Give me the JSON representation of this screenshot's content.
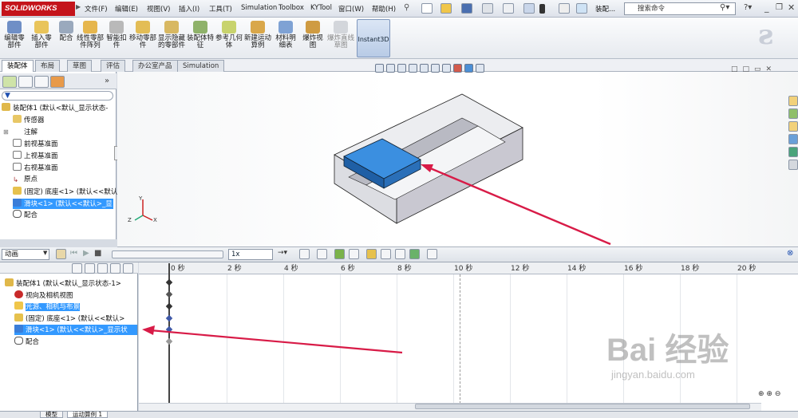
{
  "app": {
    "logo_text": "SOLIDWORKS",
    "document_title": "装配...",
    "search_placeholder": "搜索命令"
  },
  "menu": {
    "items": [
      "文件(F)",
      "编辑(E)",
      "视图(V)",
      "插入(I)",
      "工具(T)",
      "Simulation",
      "Toolbox",
      "KYTool",
      "窗口(W)",
      "帮助(H)"
    ]
  },
  "commands": {
    "items": [
      "编辑零部件",
      "插入零部件",
      "配合",
      "线性零部件阵列",
      "智能扣件",
      "移动零部件",
      "显示隐藏的零部件",
      "装配体特征",
      "参考几何体",
      "新建运动算例",
      "材料明细表",
      "爆炸视图",
      "爆炸直线草图"
    ],
    "instant3d": "Instant3D"
  },
  "tabs": [
    "装配体",
    "布局",
    "草图",
    "评估",
    "办公室产品",
    "Simulation"
  ],
  "feature_tree": {
    "items": [
      "装配体1 (默认<默认_显示状态-",
      "传感器",
      "注解",
      "前视基准面",
      "上视基准面",
      "右视基准面",
      "原点",
      "(固定) 底座<1> (默认<<默认",
      "滑块<1> (默认<<默认>_显",
      "配合"
    ]
  },
  "motion": {
    "study_type": "动画",
    "speed_value": "1x",
    "tree": [
      "装配体1 (默认<默认_显示状态-1>",
      "视向及相机视图",
      "光源、相机与布景",
      "(固定) 底座<1> (默认<<默认>",
      "滑块<1> (默认<<默认>_显示状",
      "配合"
    ],
    "time_labels": [
      "0 秒",
      "2 秒",
      "4 秒",
      "6 秒",
      "8 秒",
      "10 秒",
      "12 秒",
      "14 秒",
      "16 秒",
      "18 秒",
      "20 秒"
    ]
  },
  "bottom_tabs": [
    "模型",
    "运动算例 1"
  ],
  "triad": {
    "x": "X",
    "y": "Y",
    "z": "Z"
  },
  "watermark": {
    "brand": "Bai 经验",
    "url": "jingyan.baidu.com"
  },
  "colors": {
    "selection": "#3399ff",
    "slider_part": "#3b8fe0",
    "arrow": "#d81b47",
    "logo": "#c4141b"
  }
}
